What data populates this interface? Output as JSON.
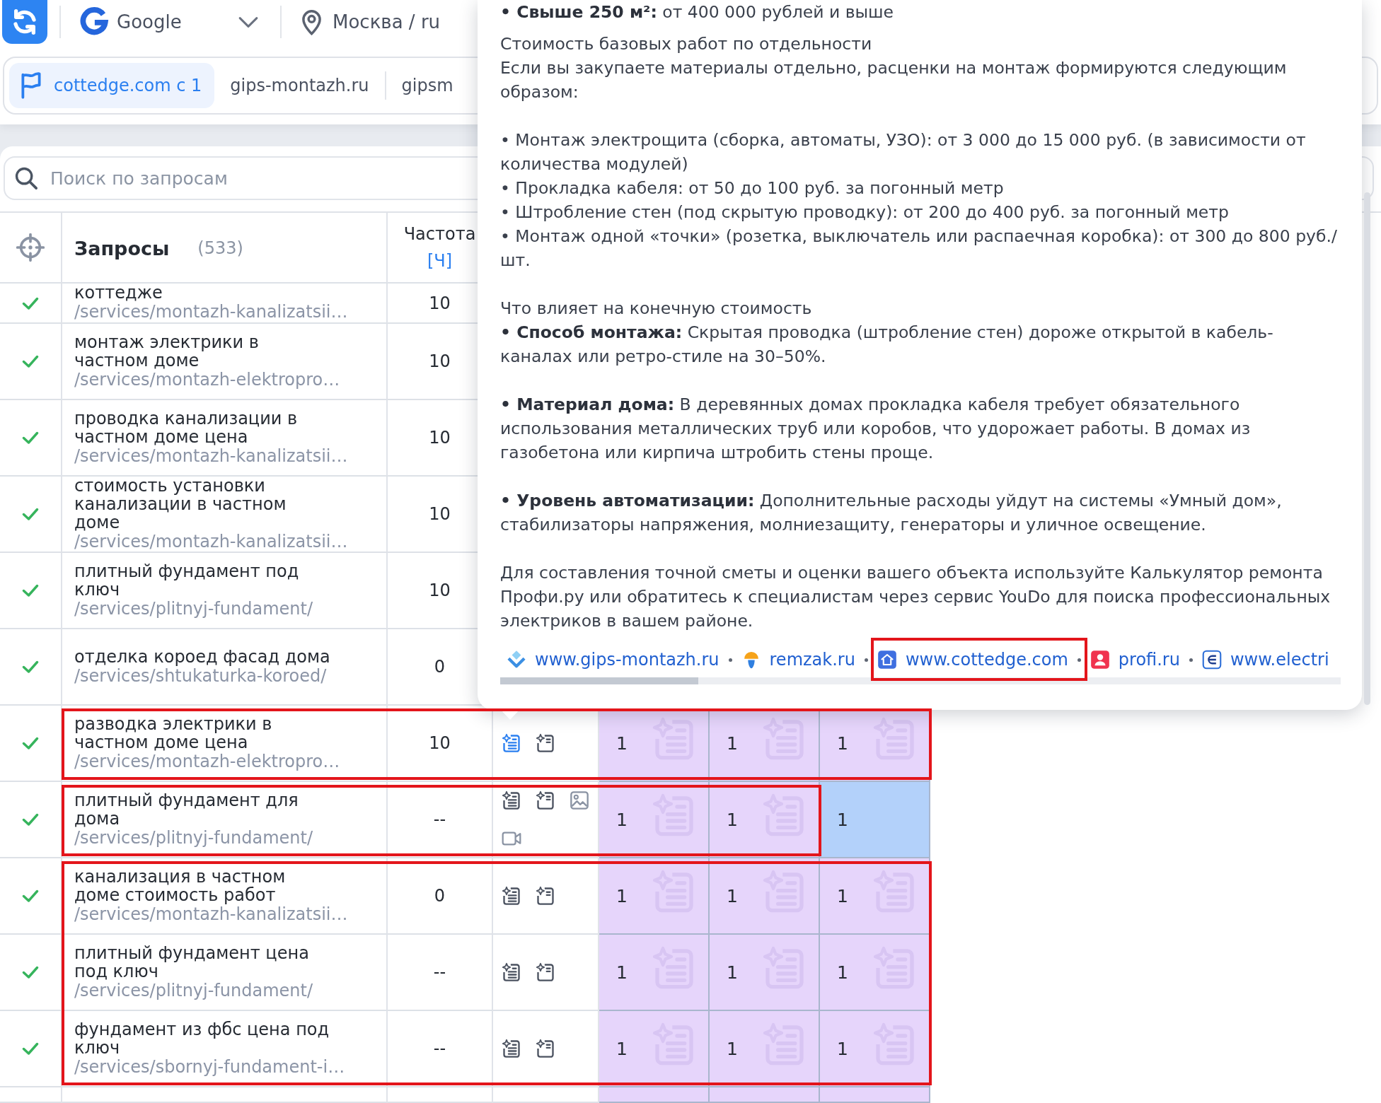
{
  "toolbar": {
    "engine": "Google",
    "region": "Москва / ru"
  },
  "site_tabs": [
    {
      "label": "cottedge.com с 1",
      "selected": true,
      "flagged": true
    },
    {
      "label": "gips-montazh.ru",
      "selected": false,
      "flagged": false
    },
    {
      "label": "gipsm",
      "selected": false,
      "flagged": false
    }
  ],
  "search": {
    "placeholder": "Поиск по запросам"
  },
  "table": {
    "title": "Запросы",
    "count": "(533)",
    "frequency_header": {
      "label": "Частота",
      "mode": "[Ч]"
    },
    "rows": [
      {
        "kind": "cut_row",
        "checked": true,
        "query": "коттедже",
        "path": "/services/montazh-kanalizatsii…",
        "frequency": "10"
      },
      {
        "kind": "row",
        "checked": true,
        "query": "монтаж электрики в частном доме",
        "path": "/services/montazh-elektropro…",
        "frequency": "10"
      },
      {
        "kind": "row",
        "checked": true,
        "query": "проводка канализации в частном доме цена",
        "path": "/services/montazh-kanalizatsii…",
        "frequency": "10"
      },
      {
        "kind": "row",
        "checked": true,
        "query": "стоимость установки канализации в частном доме",
        "path": "/services/montazh-kanalizatsii…",
        "frequency": "10"
      },
      {
        "kind": "row",
        "checked": true,
        "query": "плитный фундамент под ключ",
        "path": "/services/plitnyj-fundament/",
        "frequency": "10"
      },
      {
        "kind": "row",
        "checked": true,
        "query": "отделка короед фасад дома",
        "path": "/services/shtukaturka-koroed/",
        "frequency": "0"
      },
      {
        "kind": "outlined",
        "covers_last_cell": true,
        "rows": [
          {
            "checked": true,
            "query": "разводка электрики в частном доме цена",
            "path": "/services/montazh-elektropro…",
            "frequency": "10",
            "tools": [
              {
                "kind": "list",
                "active": true
              },
              {
                "kind": "note",
                "active": false
              }
            ],
            "cells": [
              {
                "value": "1",
                "selected": false
              },
              {
                "value": "1",
                "selected": false
              },
              {
                "value": "1",
                "selected": false
              }
            ]
          }
        ]
      },
      {
        "kind": "outlined",
        "covers_last_cell": false,
        "rows": [
          {
            "checked": true,
            "query": "плитный фундамент для дома",
            "path": "/services/plitnyj-fundament/",
            "frequency": "--",
            "tools": [
              {
                "kind": "list",
                "active": false
              },
              {
                "kind": "note",
                "active": false
              },
              {
                "kind": "image",
                "active": false
              },
              {
                "kind": "video",
                "active": false
              }
            ],
            "cells": [
              {
                "value": "1",
                "selected": false
              },
              {
                "value": "1",
                "selected": false
              },
              {
                "value": "1",
                "selected": true
              }
            ]
          }
        ]
      },
      {
        "kind": "outlined",
        "covers_last_cell": true,
        "rows": [
          {
            "checked": true,
            "query": "канализация в частном доме стоимость работ",
            "path": "/services/montazh-kanalizatsii…",
            "frequency": "0",
            "tools": [
              {
                "kind": "list",
                "active": false
              },
              {
                "kind": "note",
                "active": false
              }
            ],
            "cells": [
              {
                "value": "1",
                "selected": false
              },
              {
                "value": "1",
                "selected": false
              },
              {
                "value": "1",
                "selected": false
              }
            ]
          },
          {
            "checked": true,
            "query": "плитный фундамент цена под ключ",
            "path": "/services/plitnyj-fundament/",
            "frequency": "--",
            "tools": [
              {
                "kind": "list",
                "active": false
              },
              {
                "kind": "note",
                "active": false
              }
            ],
            "cells": [
              {
                "value": "1",
                "selected": false
              },
              {
                "value": "1",
                "selected": false
              },
              {
                "value": "1",
                "selected": false
              }
            ]
          },
          {
            "checked": true,
            "query": "фундамент из фбс цена под ключ",
            "path": "/services/sbornyj-fundament-i…",
            "frequency": "--",
            "tools": [
              {
                "kind": "list",
                "active": false
              },
              {
                "kind": "note",
                "active": false
              }
            ],
            "cells": [
              {
                "value": "1",
                "selected": false
              },
              {
                "value": "1",
                "selected": false
              },
              {
                "value": "1",
                "selected": false
              }
            ]
          }
        ]
      },
      {
        "kind": "row",
        "cells": [
          {
            "selected": false
          },
          {
            "selected": false
          },
          {
            "selected": false
          }
        ]
      }
    ]
  },
  "popup": {
    "paragraphs": [
      {
        "lines": [
          "**• Свыше 250 м²:** от 400 000 рублей и выше"
        ]
      },
      {
        "lines": [
          "Стоимость базовых работ по отдельности",
          "Если вы закупаете материалы отдельно, расценки на монтаж формируются следующим образом:"
        ]
      },
      {
        "lines": [
          "• Монтаж электрощита (сборка, автоматы, УЗО): от 3 000 до 15 000 руб. (в зависимости от количества модулей)",
          "• Прокладка кабеля: от 50 до 100 руб. за погонный метр",
          "• Штробление стен (под скрытую проводку): от 200 до 400 руб. за погонный метр",
          "• Монтаж одной «точки» (розетка, выключатель или распаечная коробка): от 300 до 800 руб./шт."
        ]
      },
      {
        "lines": [
          "Что влияет на конечную стоимость",
          "**• Способ монтажа:** Скрытая проводка (штробление стен) дороже открытой в кабель-каналах или ретро-стиле на 30–50%."
        ]
      },
      {
        "lines": [
          "**• Материал дома:** В деревянных домах прокладка кабеля требует обязательного использования металлических труб или коробов, что удорожает работы. В домах из газобетона или кирпича штробить стены проще."
        ]
      },
      {
        "lines": [
          "**• Уровень автоматизации:** Дополнительные расходы уйдут на системы «Умный дом», стабилизаторы напряжения, молниезащиту, генераторы и уличное освещение."
        ]
      },
      {
        "lines": [
          "Для составления точной сметы и оценки вашего объекта используйте Калькулятор ремонта Профи.ру или обратитесь к специалистам через сервис YouDo для поиска профессиональных электриков в вашем районе."
        ]
      }
    ],
    "sources": [
      {
        "label": "www.gips-montazh.ru",
        "kind": "diamond",
        "framed": false
      },
      {
        "label": "remzak.ru",
        "kind": "helmet",
        "framed": false
      },
      {
        "label": "www.cottedge.com",
        "kind": "house",
        "framed": true
      },
      {
        "label": "profi.ru",
        "kind": "person",
        "framed": false
      },
      {
        "label": "www.electri",
        "kind": "emblem",
        "framed": false
      }
    ]
  }
}
